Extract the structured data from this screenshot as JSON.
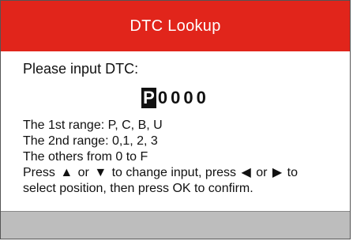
{
  "title": "DTC Lookup",
  "prompt": "Please input DTC:",
  "code": {
    "selected": "P",
    "rest": "0000"
  },
  "ranges": {
    "first": "The 1st range: P, C, B, U",
    "second": "The 2nd range: 0,1, 2, 3",
    "others": "The others from  0  to  F"
  },
  "instructions": {
    "part1": "Press ",
    "part2": " or ",
    "part3": " to change input, press ",
    "part4": " or ",
    "part5": " to",
    "line2": "select position, then press OK to confirm."
  },
  "icons": {
    "up": "up-arrow-icon",
    "down": "down-arrow-icon",
    "left": "left-arrow-icon",
    "right": "right-arrow-icon"
  },
  "colors": {
    "title_bg": "#e1251b",
    "footer_bg": "#bdbdbd"
  }
}
